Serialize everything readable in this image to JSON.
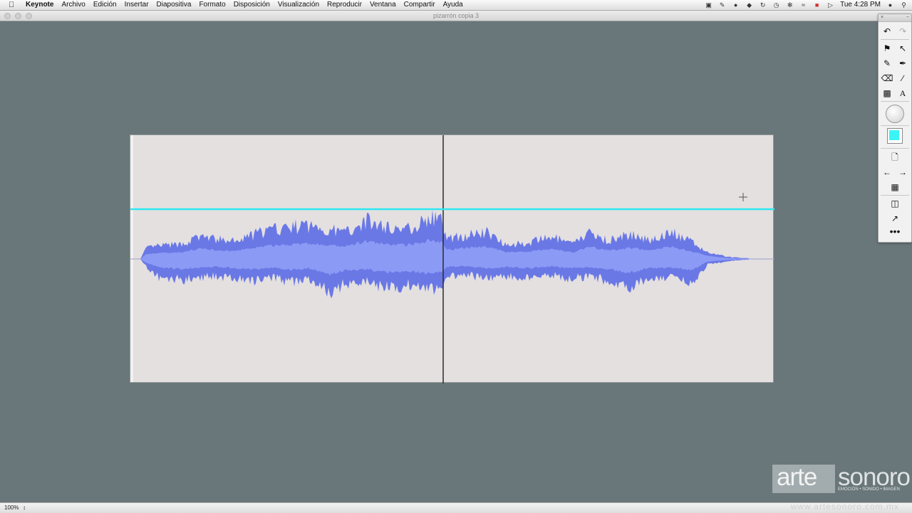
{
  "menubar": {
    "apple": "",
    "app": "Keynote",
    "items": [
      "Archivo",
      "Edición",
      "Insertar",
      "Diapositiva",
      "Formato",
      "Disposición",
      "Visualización",
      "Reproducir",
      "Ventana",
      "Compartir",
      "Ayuda"
    ],
    "clock": "Tue 4:28 PM",
    "status_icons": [
      "camera-icon",
      "pen-icon",
      "evernote-icon",
      "dropbox-icon",
      "sync-icon",
      "time-machine-icon",
      "bluetooth-icon",
      "wifi-icon",
      "flag-icon",
      "volume-icon",
      "user-icon",
      "search-icon"
    ]
  },
  "window": {
    "title": "pizarrón copia 3"
  },
  "palette": {
    "head_left": "×",
    "head_right": "−",
    "accent_color": "#3cf3f5"
  },
  "slide": {
    "waveform_color": "#6a78e6",
    "waveform_light": "#8b9af5",
    "cursor_line_color": "#2ee8f0"
  },
  "statusbar": {
    "zoom": "100%",
    "arrow": "↕",
    "watermark_url": "www.artesonoro.com.mx"
  },
  "watermark": {
    "arte": "arte",
    "sonoro": "sonoro",
    "tagline": "EMOCIÓN • SONIDO • IMAGEN"
  }
}
